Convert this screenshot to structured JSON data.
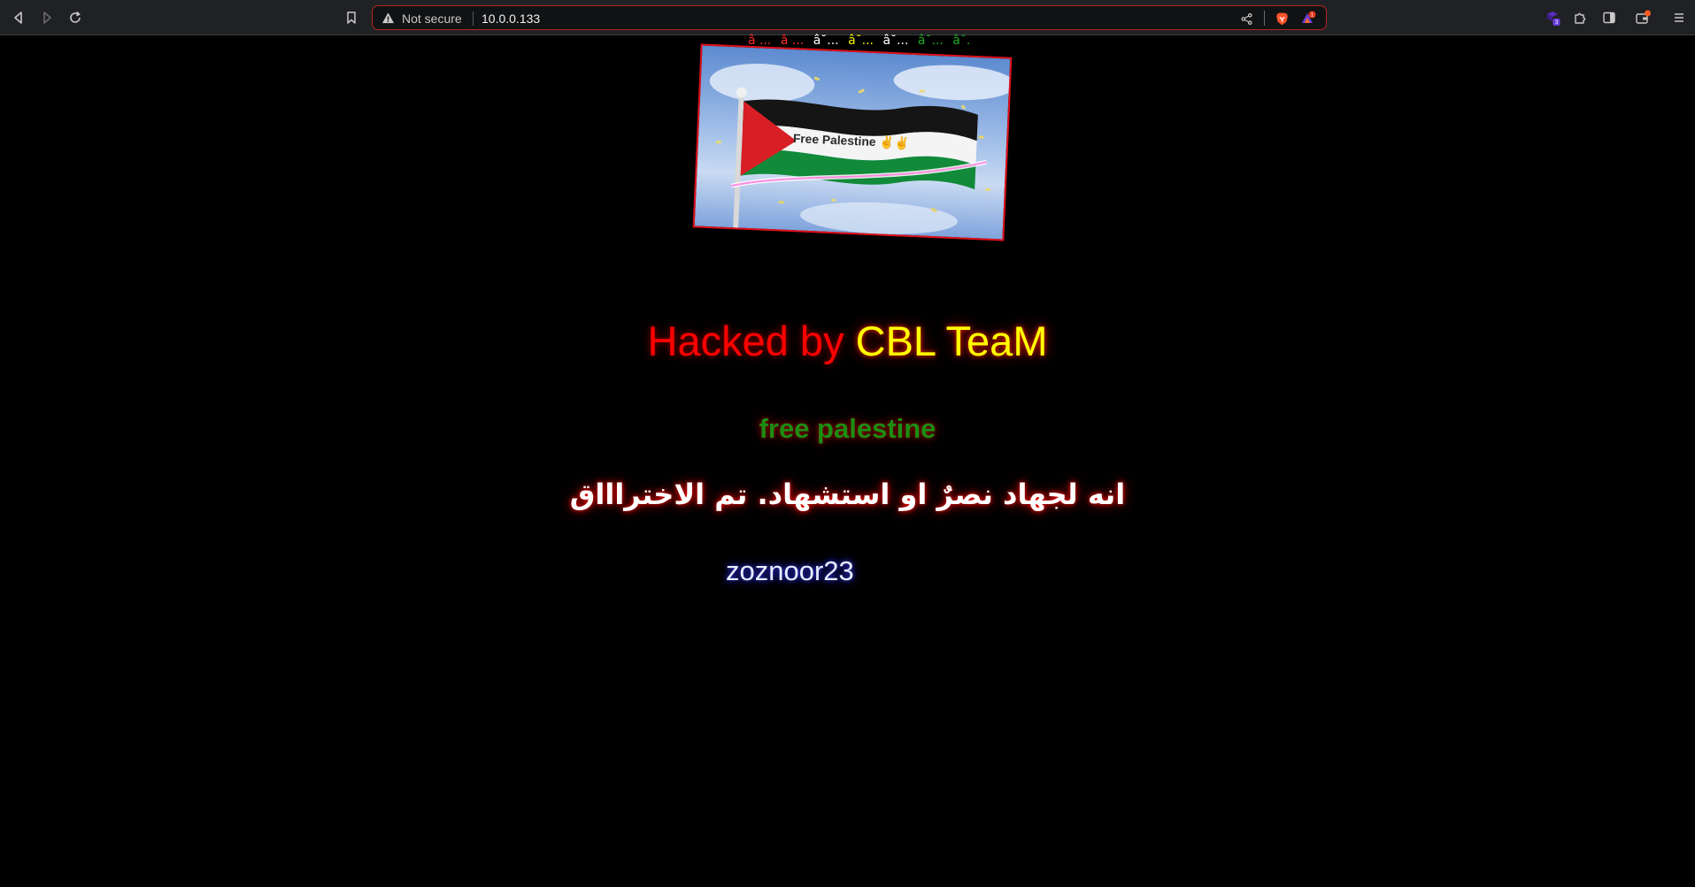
{
  "browser": {
    "security_label": "Not secure",
    "url": "10.0.0.133",
    "extensions_badge": "3",
    "brave_rewards_badge": "1"
  },
  "page": {
    "marquee_items": [
      {
        "text": "â ...",
        "color": "#ff2a2a"
      },
      {
        "text": "â ...",
        "color": "#ff2a2a"
      },
      {
        "text": "â˘...",
        "color": "#ffffff"
      },
      {
        "text": "â˘...",
        "color": "#f2f200"
      },
      {
        "text": "â˘...",
        "color": "#ffffff"
      },
      {
        "text": "â˘...",
        "color": "#1faa1f"
      },
      {
        "text": "â˘...",
        "color": "#1faa1f"
      }
    ],
    "banner_text": "Free Palestine ✌✌",
    "headline_part1": "Hacked by ",
    "headline_part2": "CBL TeaM",
    "subline": "free palestine",
    "arabic_text": "انه لجهاد نصرٌ او استشهاد. تم الاختراااق",
    "signature": "zoznoor23"
  },
  "colors": {
    "headline_red": "#ff0000",
    "headline_yellow": "#ffff00",
    "subline_green": "#1c8d13",
    "omnibox_border": "#b3261e"
  }
}
